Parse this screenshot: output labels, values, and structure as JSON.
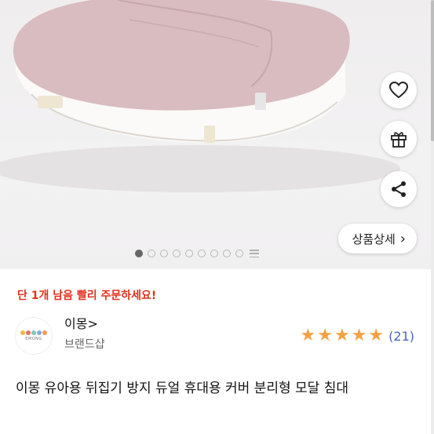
{
  "product_images": {
    "current_index": 1,
    "total": 9
  },
  "actions": {
    "wishlist_icon": "heart-outline-icon",
    "gift_icon": "gift-icon",
    "share_icon": "share-icon",
    "detail_label": "상품상세",
    "detail_chevron": "›"
  },
  "stock_notice": "단 1개 남음 빨리 주문하세요!",
  "seller": {
    "name": "이몽>",
    "subtitle": "브랜드샵",
    "logo_text": "EMONG",
    "rating_stars": 5,
    "review_count": "(21)"
  },
  "product": {
    "title": "이몽 유아용 뒤집기 방지 듀얼 휴대용 커버 분리형 모달 침대"
  },
  "colors": {
    "star": "#f4a142",
    "stock_red": "#e0321e",
    "review_blue": "#4a62c4",
    "pillow_pink": "#d9bcc0",
    "logo_dots": [
      "#f4b942",
      "#e7706f",
      "#7ecbb8",
      "#8aa8e0",
      "#f39b5a"
    ]
  }
}
